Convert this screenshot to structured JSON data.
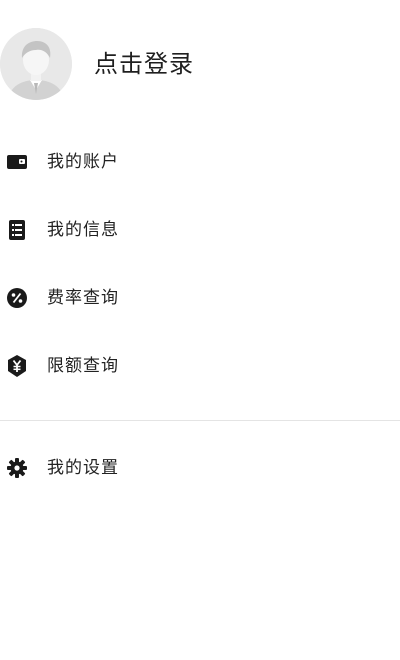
{
  "header": {
    "login_label": "点击登录",
    "avatar_icon": "default-avatar-icon"
  },
  "menu": {
    "items": [
      {
        "label": "我的账户",
        "icon": "wallet-icon"
      },
      {
        "label": "我的信息",
        "icon": "list-icon"
      },
      {
        "label": "费率查询",
        "icon": "percent-icon"
      },
      {
        "label": "限额查询",
        "icon": "yen-shield-icon"
      }
    ]
  },
  "settings": {
    "label": "我的设置",
    "icon": "gear-icon"
  },
  "colors": {
    "text": "#222222",
    "icon": "#1a1a1a",
    "divider": "#e4e4e4",
    "avatar_bg": "#e6e6e6"
  }
}
